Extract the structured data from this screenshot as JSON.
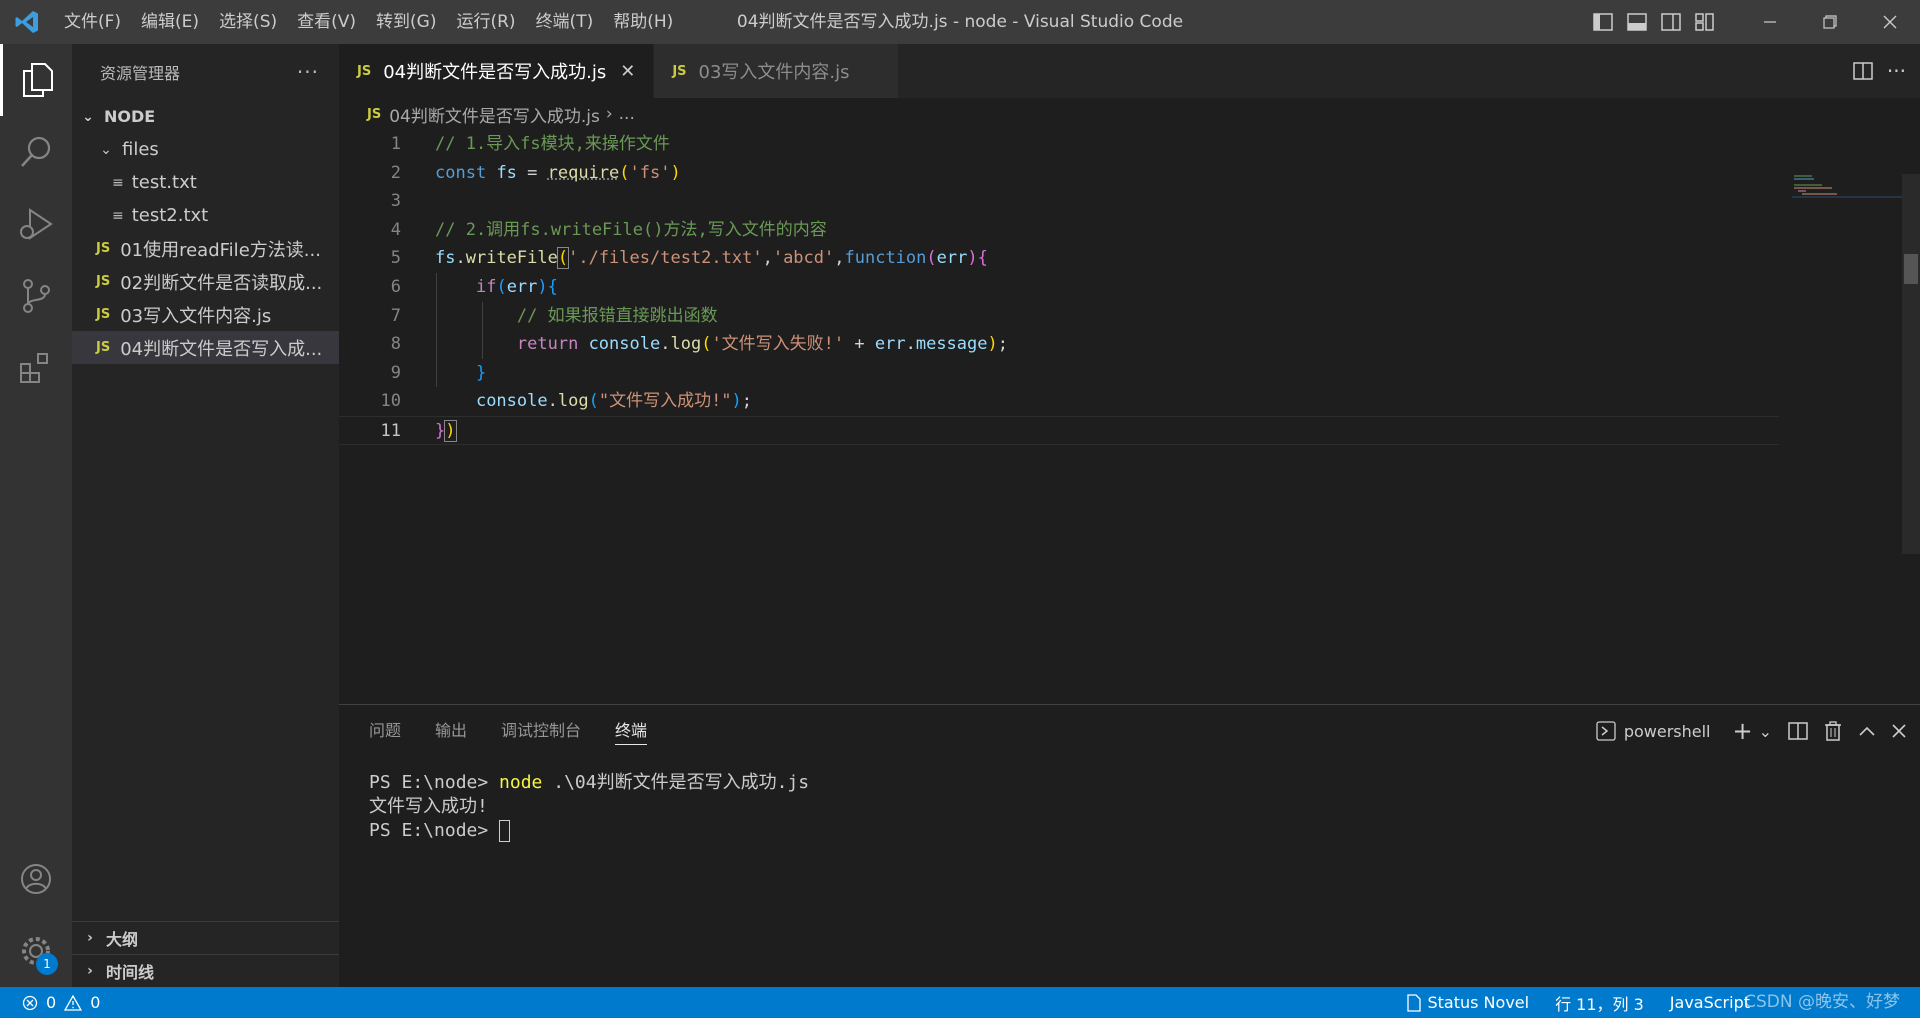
{
  "titlebar": {
    "window_title": "04判断文件是否写入成功.js - node - Visual Studio Code",
    "menu": [
      "文件(F)",
      "编辑(E)",
      "选择(S)",
      "查看(V)",
      "转到(G)",
      "运行(R)",
      "终端(T)",
      "帮助(H)"
    ]
  },
  "activitybar": {
    "badge": "1"
  },
  "sidebar": {
    "title": "资源管理器",
    "root": "NODE",
    "folder": "files",
    "folder_files": [
      "test.txt",
      "test2.txt"
    ],
    "js_files": [
      "01使用readFile方法读...",
      "02判断文件是否读取成...",
      "03写入文件内容.js",
      "04判断文件是否写入成..."
    ],
    "outline": "大纲",
    "timeline": "时间线"
  },
  "editor": {
    "tabs": [
      {
        "label": "04判断文件是否写入成功.js",
        "active": true
      },
      {
        "label": "03写入文件内容.js",
        "active": false
      }
    ],
    "js_badge": "JS",
    "breadcrumb": {
      "file": "04判断文件是否写入成功.js",
      "rest": "..."
    },
    "line_numbers": [
      "1",
      "2",
      "3",
      "4",
      "5",
      "6",
      "7",
      "8",
      "9",
      "10",
      "11"
    ],
    "code": {
      "l1": "// 1.导入fs模块,来操作文件",
      "l2_const": "const",
      "l2_fs": "fs",
      "l2_eq": " = ",
      "l2_require": "require",
      "l2_arg": "'fs'",
      "l4": "// 2.调用fs.writeFile()方法,写入文件的内容",
      "l5_fs": "fs",
      "l5_fn": "writeFile",
      "l5_arg1": "'./files/test2.txt'",
      "l5_arg2": "'abcd'",
      "l5_function": "function",
      "l5_err": "err",
      "l6_if": "if",
      "l6_err": "err",
      "l7": "// 如果报错直接跳出函数",
      "l8_return": "return",
      "l8_console": "console",
      "l8_log": "log",
      "l8_str": "'文件写入失败!'",
      "l8_plus": " + ",
      "l8_err": "err",
      "l8_msg": "message",
      "l10_console": "console",
      "l10_log": "log",
      "l10_str": "\"文件写入成功!\""
    }
  },
  "panel": {
    "tabs": [
      "问题",
      "输出",
      "调试控制台",
      "终端"
    ],
    "active_tab": "终端",
    "shell": "powershell",
    "terminal": {
      "prompt1": "PS E:\\node> ",
      "cmd": "node",
      "cmd_arg": " .\\04判断文件是否写入成功.js",
      "output": "文件写入成功!",
      "prompt2": "PS E:\\node> "
    }
  },
  "statusbar": {
    "errors": "0",
    "warnings": "0",
    "status_novel": "Status Novel",
    "position": "行 11，列 3",
    "language": "JavaScript",
    "watermark": "CSDN @晚安、好梦"
  }
}
